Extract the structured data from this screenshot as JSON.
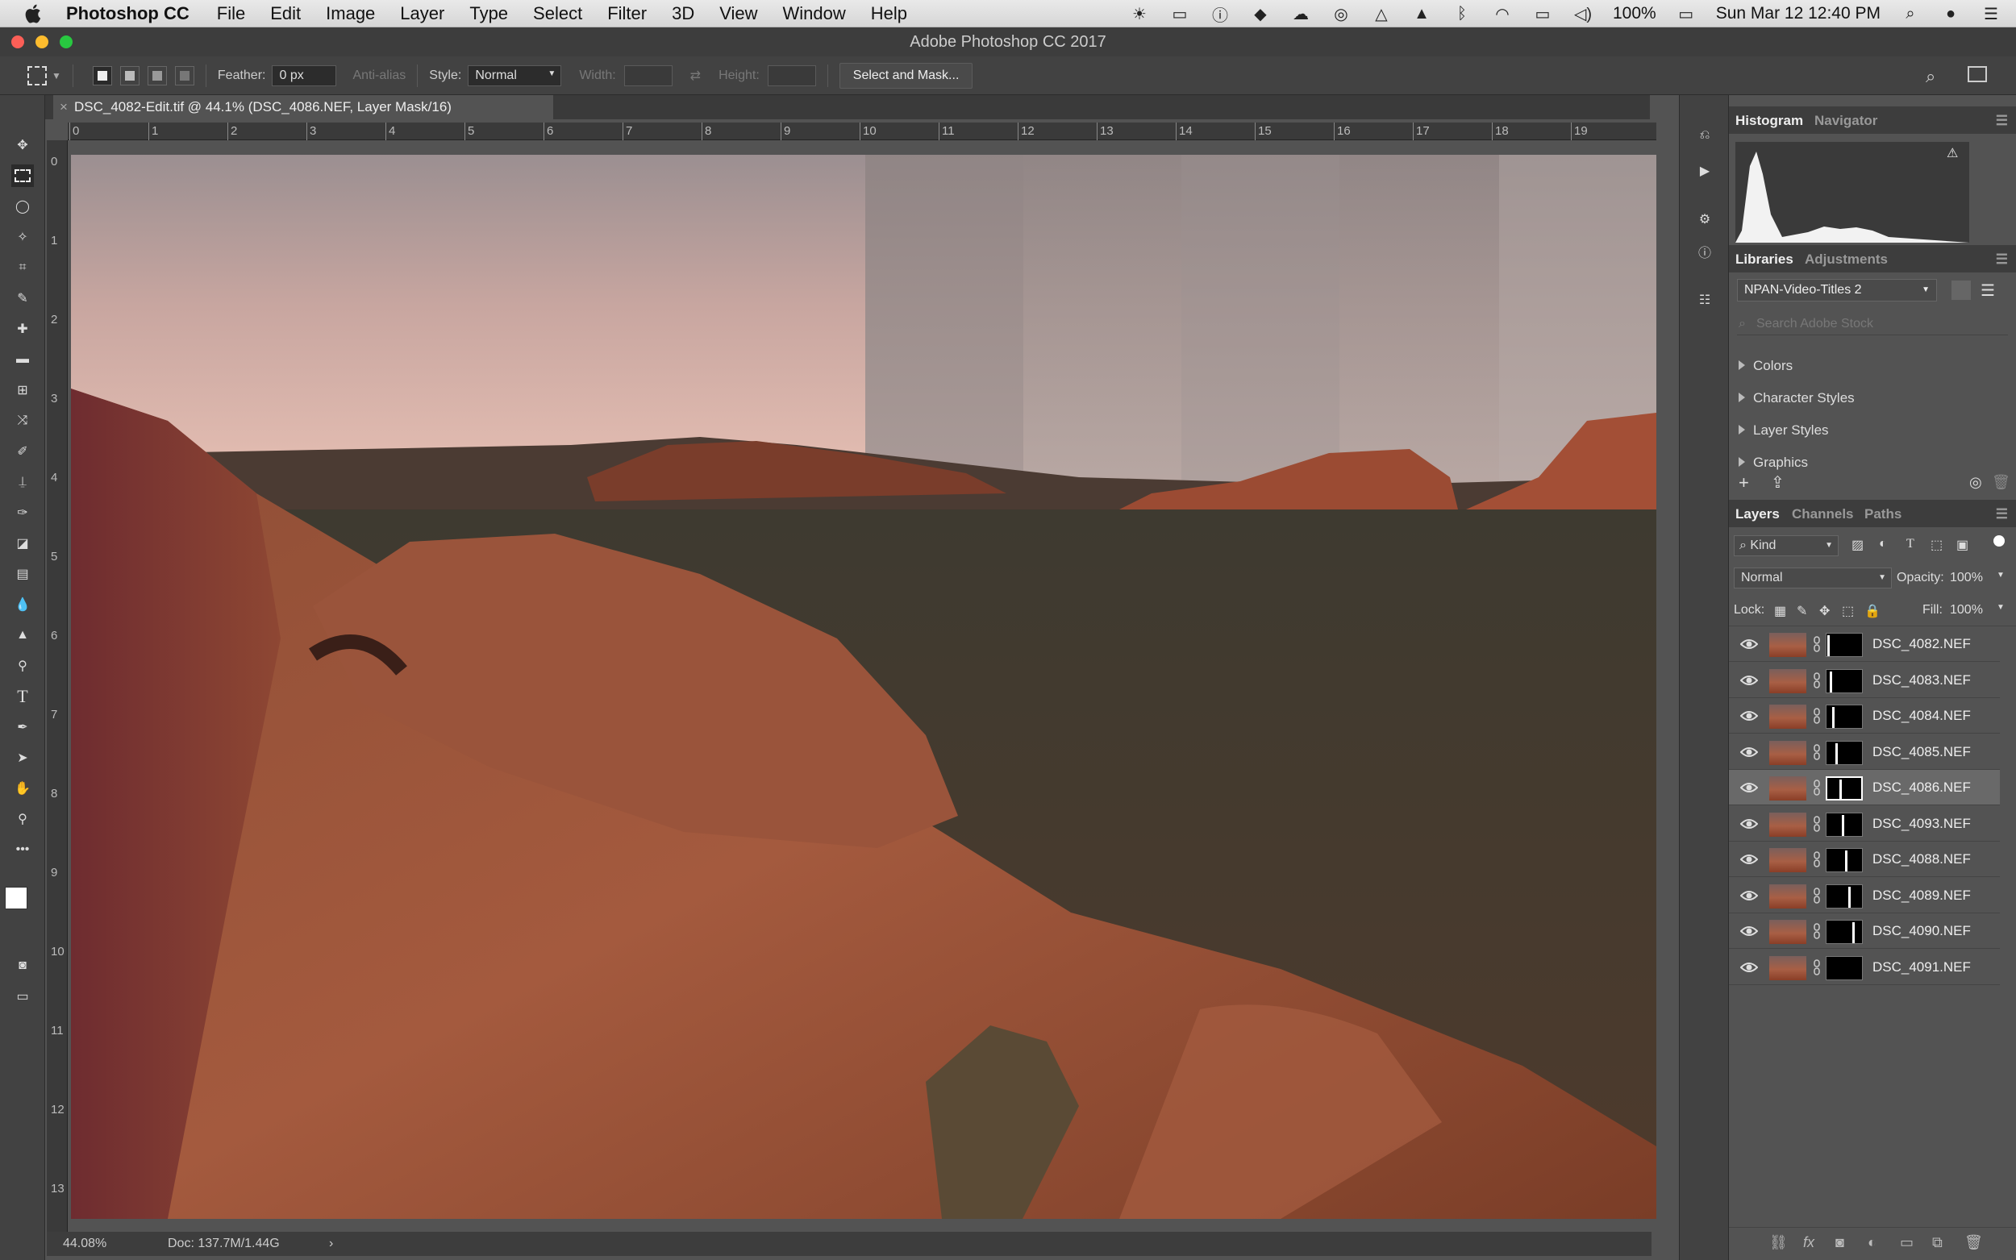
{
  "menubar": {
    "app_name": "Photoshop CC",
    "items": [
      "File",
      "Edit",
      "Image",
      "Layer",
      "Type",
      "Select",
      "Filter",
      "3D",
      "View",
      "Window",
      "Help"
    ],
    "battery": "100%",
    "clock": "Sun Mar 12  12:40 PM"
  },
  "window_title": "Adobe Photoshop CC 2017",
  "options": {
    "feather_label": "Feather:",
    "feather_value": "0 px",
    "antialias_label": "Anti-alias",
    "style_label": "Style:",
    "style_value": "Normal",
    "width_label": "Width:",
    "height_label": "Height:",
    "select_mask_label": "Select and Mask..."
  },
  "document": {
    "tab_title": "DSC_4082-Edit.tif @ 44.1% (DSC_4086.NEF, Layer Mask/16)",
    "zoom": "44.08%",
    "doc_size": "Doc: 137.7M/1.44G"
  },
  "rulers": {
    "h_ticks": [
      "0",
      "1",
      "2",
      "3",
      "4",
      "5",
      "6",
      "7",
      "8",
      "9",
      "10",
      "11",
      "12",
      "13",
      "14",
      "15",
      "16",
      "17",
      "18",
      "19"
    ],
    "v_ticks": [
      "0",
      "1",
      "2",
      "3",
      "4",
      "5",
      "6",
      "7",
      "8",
      "9",
      "10",
      "11",
      "12",
      "13"
    ]
  },
  "panels": {
    "top_tabs": [
      "Histogram",
      "Navigator"
    ],
    "lib_tabs": [
      "Libraries",
      "Adjustments"
    ],
    "library_name": "NPAN-Video-Titles 2",
    "search_placeholder": "Search Adobe Stock",
    "library_sections": [
      "Colors",
      "Character Styles",
      "Layer Styles",
      "Graphics"
    ],
    "layer_tabs": [
      "Layers",
      "Channels",
      "Paths"
    ],
    "kind_label": "Kind",
    "blend_mode": "Normal",
    "opacity_label": "Opacity:",
    "opacity_value": "100%",
    "lock_label": "Lock:",
    "fill_label": "Fill:",
    "fill_value": "100%",
    "layers": [
      {
        "name": "DSC_4082.NEF",
        "mask_pos": 0.03,
        "selected": false
      },
      {
        "name": "DSC_4083.NEF",
        "mask_pos": 0.1,
        "selected": false
      },
      {
        "name": "DSC_4084.NEF",
        "mask_pos": 0.17,
        "selected": false
      },
      {
        "name": "DSC_4085.NEF",
        "mask_pos": 0.27,
        "selected": false
      },
      {
        "name": "DSC_4086.NEF",
        "mask_pos": 0.37,
        "selected": true
      },
      {
        "name": "DSC_4093.NEF",
        "mask_pos": 0.47,
        "selected": false
      },
      {
        "name": "DSC_4088.NEF",
        "mask_pos": 0.57,
        "selected": false
      },
      {
        "name": "DSC_4089.NEF",
        "mask_pos": 0.67,
        "selected": false
      },
      {
        "name": "DSC_4090.NEF",
        "mask_pos": 0.8,
        "selected": false
      },
      {
        "name": "DSC_4091.NEF",
        "mask_pos": null,
        "selected": false
      }
    ]
  }
}
